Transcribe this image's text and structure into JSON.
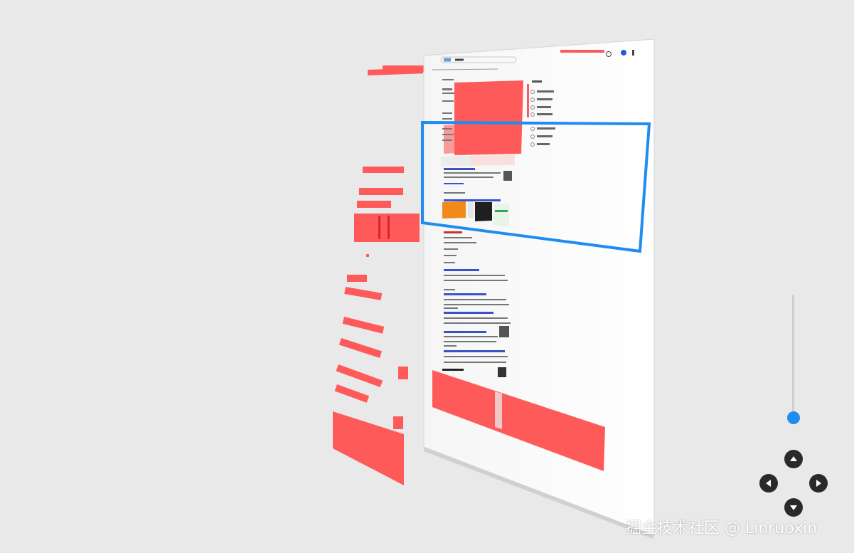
{
  "viewer": {
    "highlight_color": "#1e8cf0",
    "layer_color": "#ff5a5a",
    "background": "#e9e9e9",
    "controls": {
      "zoom_level": 0.95,
      "buttons": [
        "arrow-up-icon",
        "arrow-left-icon",
        "arrow-right-icon",
        "arrow-down-icon"
      ]
    }
  },
  "watermark": "掘金技术社区 @ Linruoxin"
}
